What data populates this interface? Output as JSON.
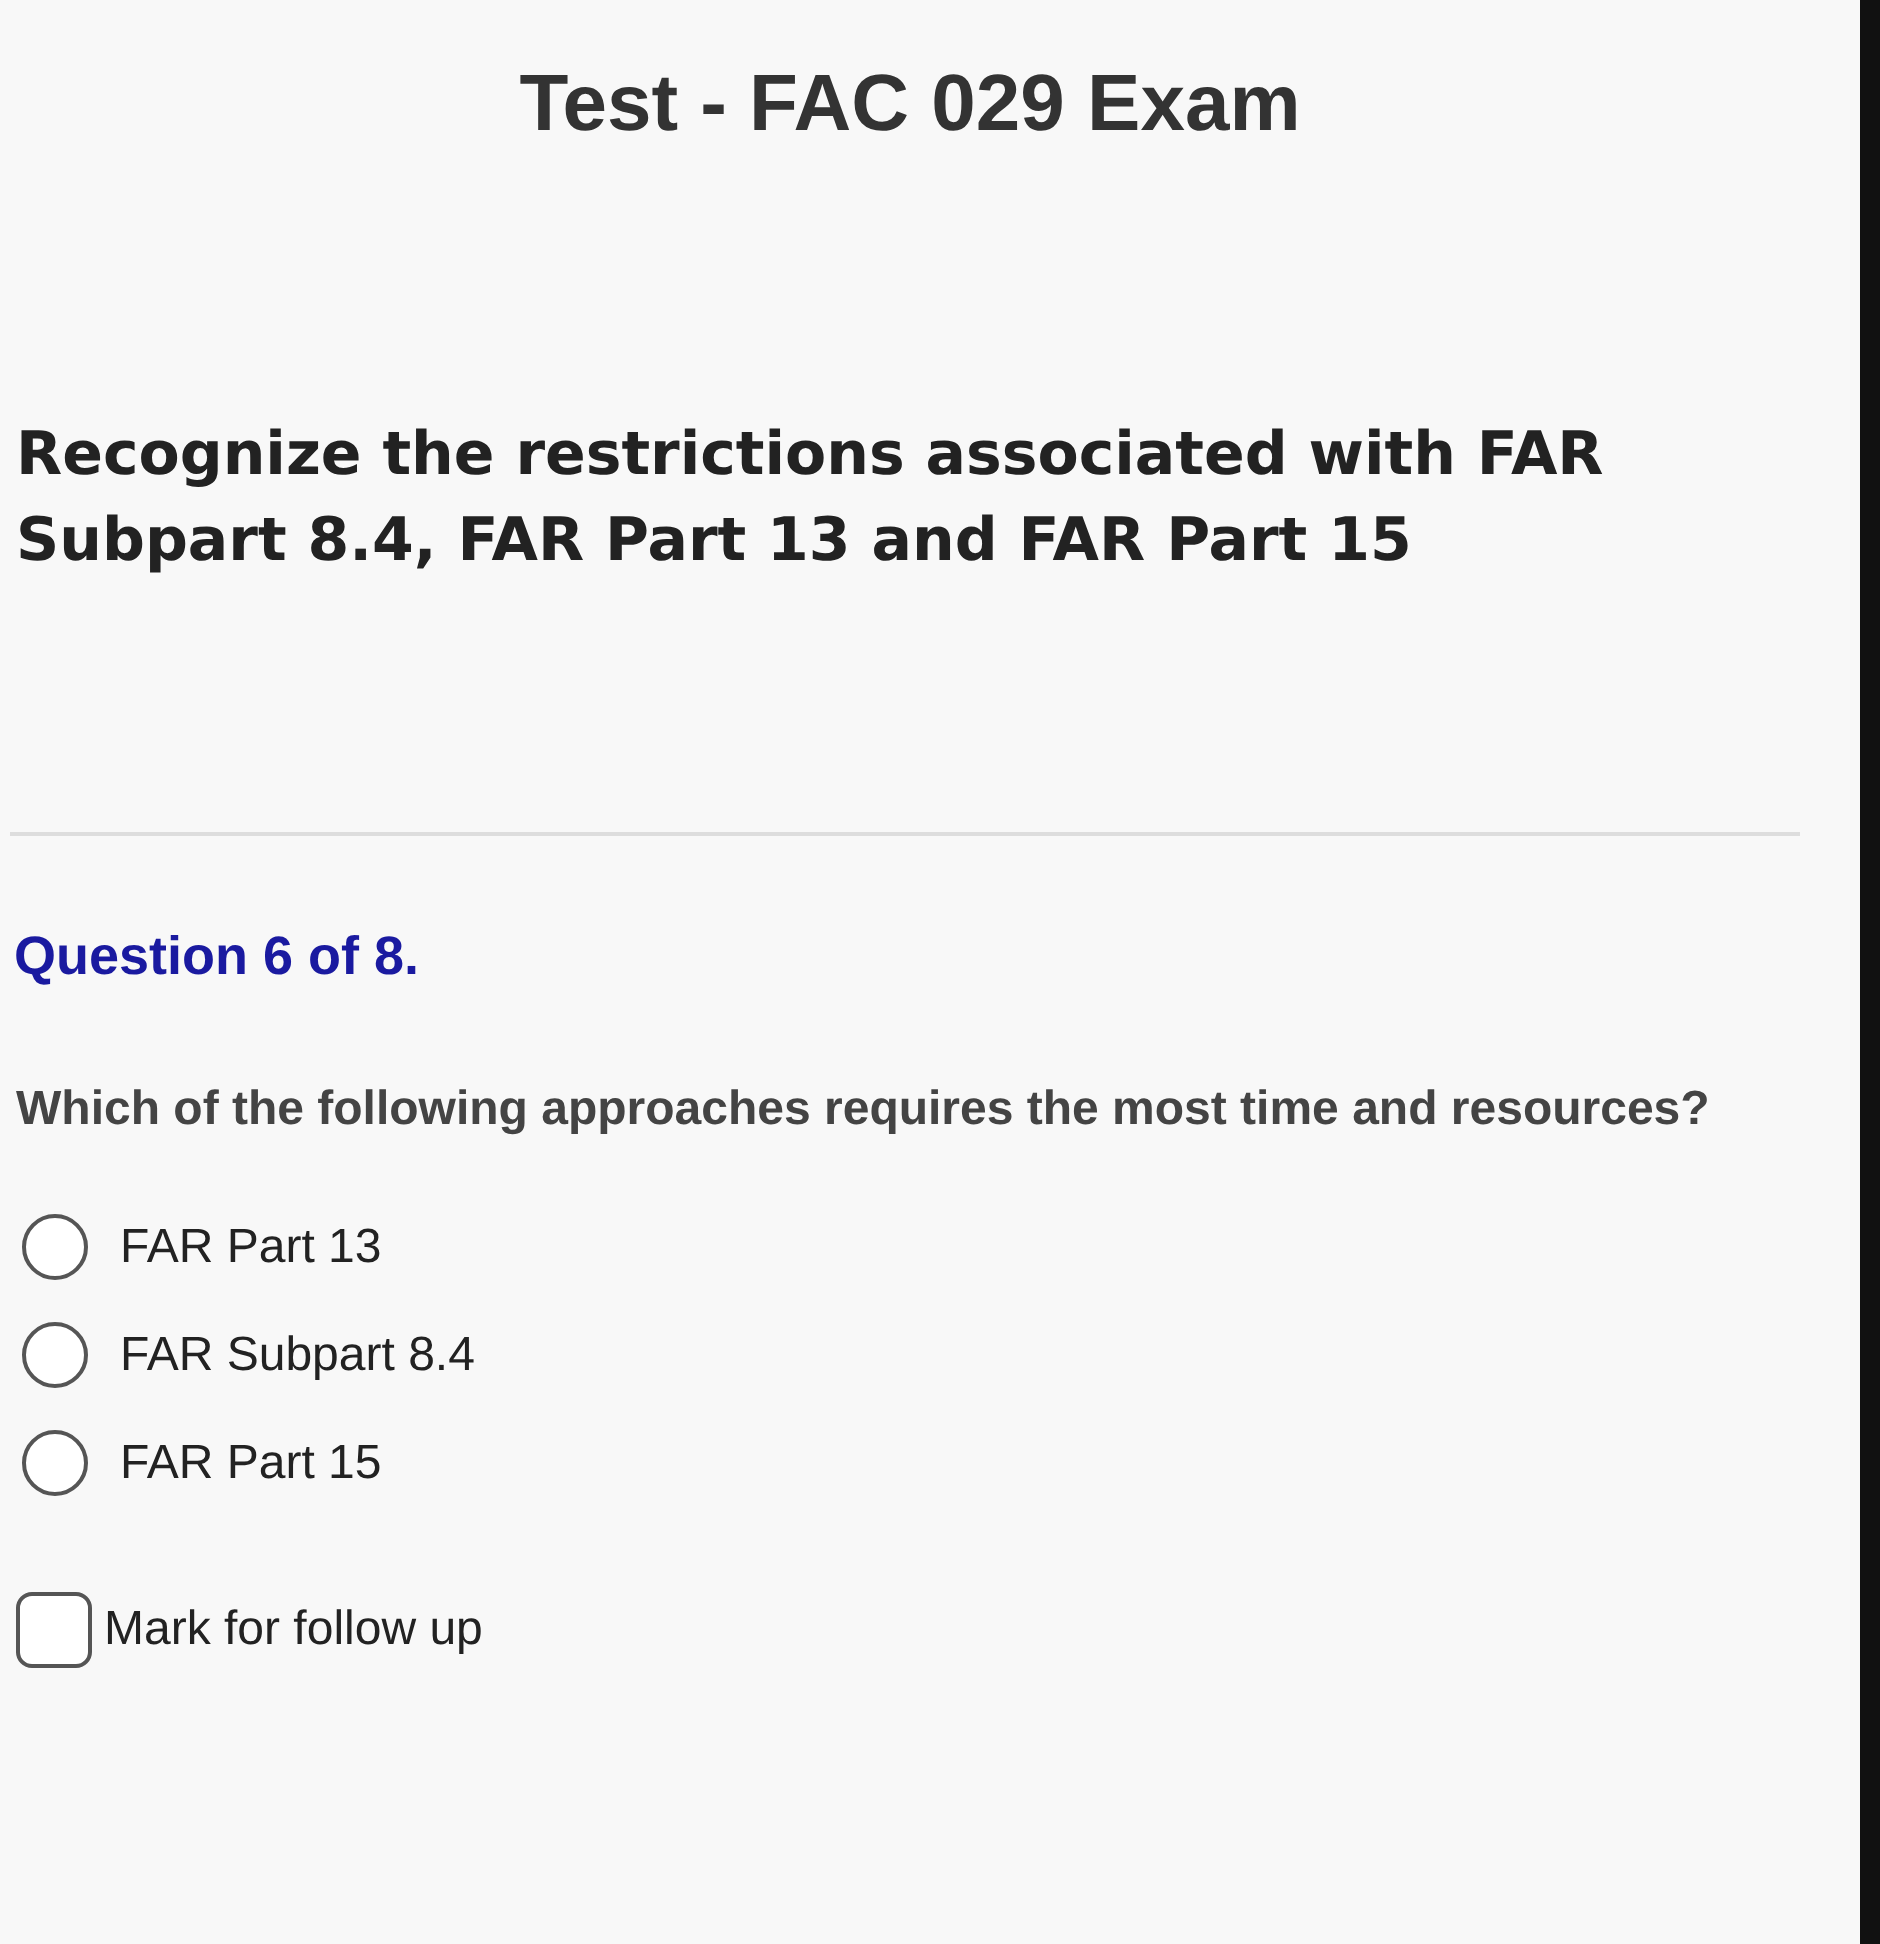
{
  "title": "Test - FAC 029 Exam",
  "objective": "Recognize the restrictions associated with FAR Subpart 8.4, FAR Part 13 and FAR Part 15",
  "question": {
    "counter": "Question 6 of 8.",
    "text": "Which of the following approaches requires the most time and resources?",
    "options": [
      {
        "label": "FAR Part 13",
        "selected": false
      },
      {
        "label": "FAR Subpart 8.4",
        "selected": false
      },
      {
        "label": "FAR Part 15",
        "selected": false
      }
    ]
  },
  "follow_up": {
    "label": "Mark for follow up",
    "checked": false
  }
}
